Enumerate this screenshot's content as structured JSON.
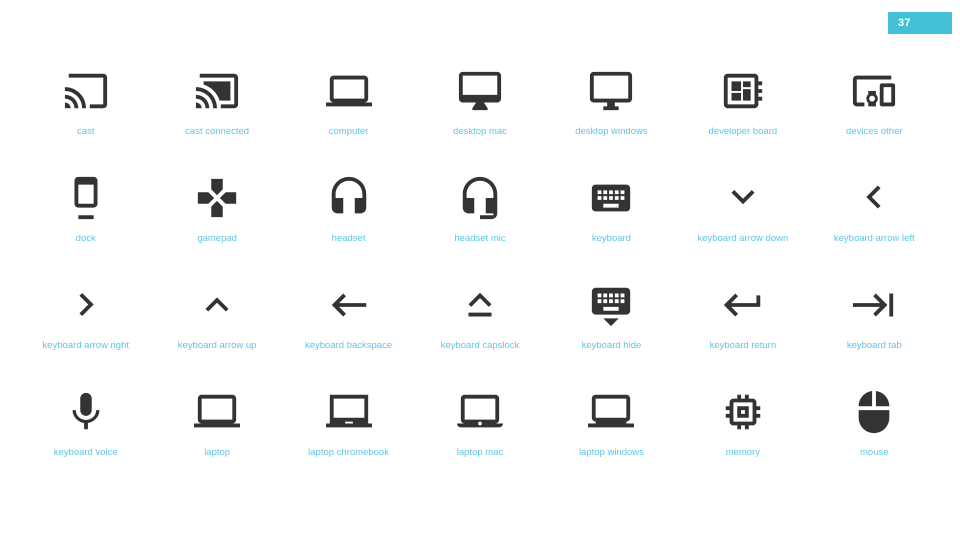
{
  "badge": {
    "number": "37",
    "background_color": "#41c0d6",
    "text_color": "#ffffff"
  },
  "theme": {
    "page_background": "#ffffff",
    "icon_color": "#333333",
    "label_color": "#5ec6e4"
  },
  "grid": {
    "columns": 7,
    "rows": 4,
    "items": [
      {
        "label": "cast",
        "icon": "cast-icon"
      },
      {
        "label": "cast connected",
        "icon": "cast-connected-icon"
      },
      {
        "label": "computer",
        "icon": "computer-icon"
      },
      {
        "label": "desktop mac",
        "icon": "desktop-mac-icon"
      },
      {
        "label": "desktop windows",
        "icon": "desktop-windows-icon"
      },
      {
        "label": "developer board",
        "icon": "developer-board-icon"
      },
      {
        "label": "devices other",
        "icon": "devices-other-icon"
      },
      {
        "label": "dock",
        "icon": "dock-icon"
      },
      {
        "label": "gamepad",
        "icon": "gamepad-icon"
      },
      {
        "label": "headset",
        "icon": "headset-icon"
      },
      {
        "label": "headset mic",
        "icon": "headset-mic-icon"
      },
      {
        "label": "keyboard",
        "icon": "keyboard-icon"
      },
      {
        "label": "keyboard arrow down",
        "icon": "keyboard-arrow-down-icon"
      },
      {
        "label": "keyboard arrow left",
        "icon": "keyboard-arrow-left-icon"
      },
      {
        "label": "keyboard arrow right",
        "icon": "keyboard-arrow-right-icon"
      },
      {
        "label": "keyboard arrow up",
        "icon": "keyboard-arrow-up-icon"
      },
      {
        "label": "keyboard backspace",
        "icon": "keyboard-backspace-icon"
      },
      {
        "label": "keyboard capslock",
        "icon": "keyboard-capslock-icon"
      },
      {
        "label": "keyboard hide",
        "icon": "keyboard-hide-icon"
      },
      {
        "label": "keyboard return",
        "icon": "keyboard-return-icon"
      },
      {
        "label": "keyboard tab",
        "icon": "keyboard-tab-icon"
      },
      {
        "label": "keyboard voice",
        "icon": "keyboard-voice-icon"
      },
      {
        "label": "laptop",
        "icon": "laptop-icon"
      },
      {
        "label": "laptop chromebook",
        "icon": "laptop-chromebook-icon"
      },
      {
        "label": "laptop mac",
        "icon": "laptop-mac-icon"
      },
      {
        "label": "laptop windows",
        "icon": "laptop-windows-icon"
      },
      {
        "label": "memory",
        "icon": "memory-icon"
      },
      {
        "label": "mouse",
        "icon": "mouse-icon"
      }
    ]
  }
}
